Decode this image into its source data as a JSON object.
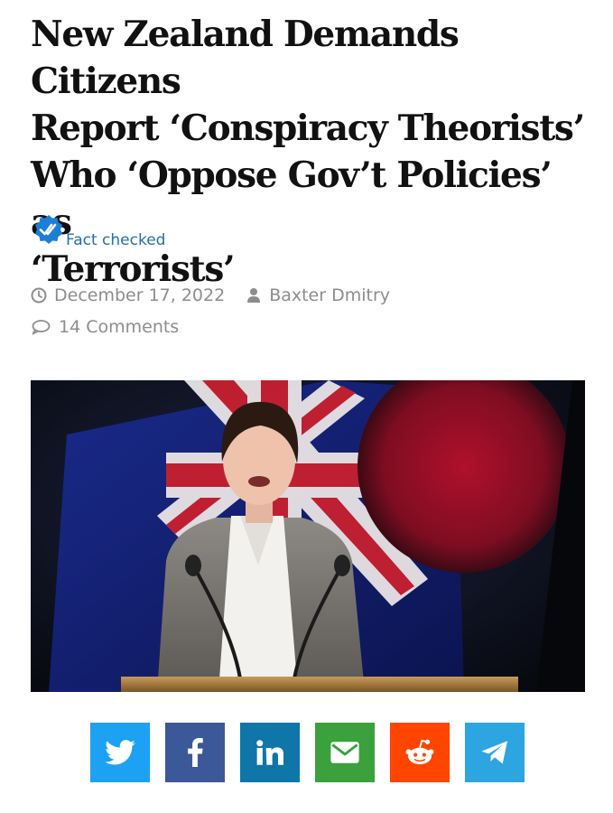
{
  "article": {
    "title_lines": [
      "New Zealand Demands Citizens",
      "Report ‘Conspiracy Theorists’",
      "Who ‘Oppose Gov’t Policies’ as",
      "‘Terrorists’"
    ],
    "fact_check_label": "Fact checked",
    "date": "December 17, 2022",
    "author": "Baxter Dmitry",
    "comments": "14 Comments",
    "hero_image_icon": "press-conference-photo"
  },
  "share": {
    "buttons": [
      {
        "network": "twitter",
        "icon": "twitter-bird-icon",
        "color": "#1da1f2"
      },
      {
        "network": "facebook",
        "icon": "facebook-f-icon",
        "color": "#3b5998"
      },
      {
        "network": "linkedin",
        "icon": "linkedin-in-icon",
        "color": "#0e76a8"
      },
      {
        "network": "email",
        "icon": "envelope-icon",
        "color": "#3aa13d"
      },
      {
        "network": "reddit",
        "icon": "reddit-alien-icon",
        "color": "#ff4500"
      },
      {
        "network": "telegram",
        "icon": "paper-plane-icon",
        "color": "#2ca5e0"
      }
    ]
  },
  "colors": {
    "headline": "#111111",
    "link": "#1f6fb4",
    "meta": "#8d8d8d",
    "badge": "#1c7fd6"
  }
}
